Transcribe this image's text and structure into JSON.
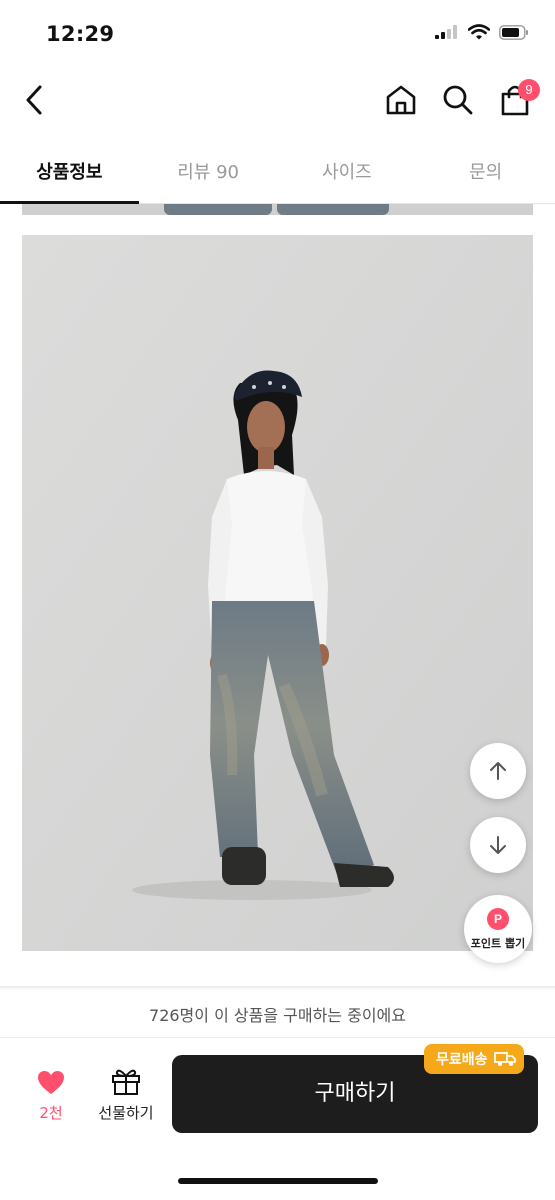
{
  "status_bar": {
    "time": "12:29",
    "icons": [
      "cellular-signal-icon",
      "wifi-icon",
      "battery-icon"
    ]
  },
  "nav": {
    "icons": [
      "back-chevron-icon",
      "home-icon",
      "search-icon",
      "shopping-bag-icon"
    ],
    "cart_count": "9"
  },
  "tabs": [
    {
      "label": "상품정보",
      "active": true
    },
    {
      "label": "리뷰 90",
      "active": false
    },
    {
      "label": "사이즈",
      "active": false
    },
    {
      "label": "문의",
      "active": false
    }
  ],
  "floating": {
    "icons": [
      "arrow-up-icon",
      "arrow-down-icon"
    ],
    "point_badge": "P",
    "point_label": "포인트 뽑기"
  },
  "buying_status": "726명이 이 상품을 구매하는 중이에요",
  "action_bar": {
    "like_count": "2천",
    "gift_label": "선물하기",
    "buy_label": "구매하기",
    "shipping_badge": "무료배송",
    "icons": [
      "heart-icon",
      "gift-icon",
      "truck-icon"
    ]
  },
  "colors": {
    "accent_pink": "#ff4f6d",
    "buy_button": "#1d1d1d",
    "shipping_badge": "#f5a81a",
    "photo_background": "#d6d6d5"
  }
}
